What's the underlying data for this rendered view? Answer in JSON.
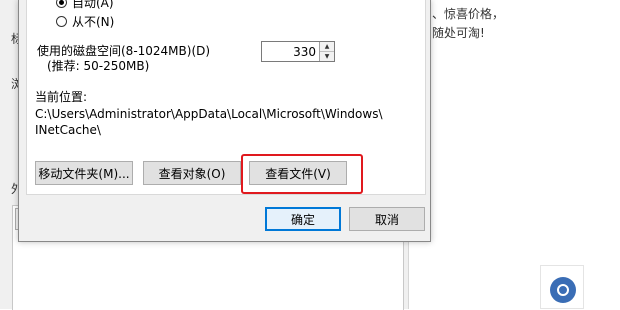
{
  "background": {
    "left_clips": [
      "标",
      "浏",
      "外"
    ],
    "ad_lines": [
      "、惊喜价格，",
      "随处可淘!"
    ]
  },
  "dialog": {
    "radio_auto_label": "自动(A)",
    "radio_never_label": "从不(N)",
    "disk_label": "使用的磁盘空间(8-1024MB)(D)",
    "disk_recommend": "(推荐: 50-250MB)",
    "disk_value": "330",
    "location_label": "当前位置:",
    "location_path_line1": "C:\\Users\\Administrator\\AppData\\Local\\Microsoft\\Windows\\",
    "location_path_line2": "INetCache\\",
    "move_folder_button": "移动文件夹(M)...",
    "view_objects_button": "查看对象(O)",
    "view_files_button": "查看文件(V)",
    "ok_button": "确定",
    "cancel_button": "取消"
  },
  "icons": {
    "spin_up": "▲",
    "spin_down": "▼",
    "settings_badge": "gear-icon"
  }
}
